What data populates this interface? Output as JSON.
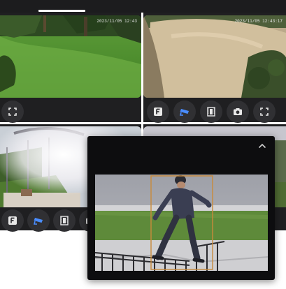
{
  "header": {
    "active_tab": ""
  },
  "cameras": [
    {
      "id": "cam-lawn",
      "timestamp": "2023/11/05 12:43",
      "controls": [
        "fullscreen-icon"
      ]
    },
    {
      "id": "cam-driveway",
      "timestamp": "2023/11/05 12:43:17",
      "controls": [
        "f-badge-icon",
        "cctv-icon",
        "film-strip-icon",
        "camera-icon",
        "fullscreen-icon"
      ]
    },
    {
      "id": "cam-walkway",
      "timestamp": "",
      "controls": [
        "f-badge-icon",
        "cctv-icon",
        "film-strip-icon",
        "camera-icon"
      ]
    },
    {
      "id": "cam-street",
      "timestamp": "",
      "controls": []
    }
  ],
  "popup": {
    "collapse_icon": "chevron-up-icon",
    "detection": "person-detection-box"
  },
  "colors": {
    "panel": "#1f1f21",
    "button": "#303033",
    "detection_box": "#c98a3a",
    "popup_bg": "#0d0d0f"
  }
}
